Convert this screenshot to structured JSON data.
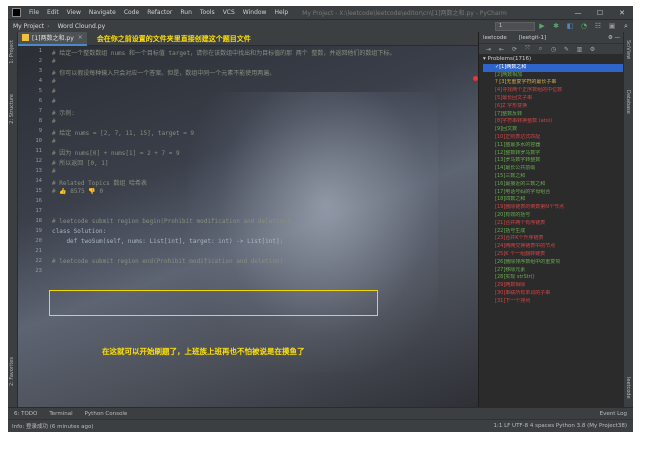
{
  "menubar": {
    "items": [
      "File",
      "Edit",
      "View",
      "Navigate",
      "Code",
      "Refactor",
      "Run",
      "Tools",
      "VCS",
      "Window",
      "Help"
    ],
    "window_title": "My Project - X:\\leetcode\\leetcode\\editor\\cn\\[1]两数之和.py - PyCharm",
    "controls": [
      "—",
      "☐",
      "✕"
    ]
  },
  "navbar": {
    "project": "My Project",
    "file": "Word Clound.py",
    "run_config": "1"
  },
  "editor": {
    "tab_label": "[1]两数之和.py",
    "hint": "会在你之前设置的文件夹里直接创建这个题目文件",
    "annotation": "在这就可以开始刷题了，上班族上班再也不怕被说是在摸鱼了",
    "lines": [
      {
        "n": "1",
        "text": "# 给定一个整数数组 nums 和一个目标值 target，请你在该数组中找出和为目标值的那 两个 整数，并返回他们的数组下标。",
        "kind": "comment"
      },
      {
        "n": "2",
        "text": "#",
        "kind": "comment"
      },
      {
        "n": "3",
        "text": "# 你可以假设每种输入只会对应一个答案。但是，数组中同一个元素不能使用两遍。",
        "kind": "comment"
      },
      {
        "n": "4",
        "text": "#",
        "kind": "comment"
      },
      {
        "n": "5",
        "text": "#",
        "kind": "comment"
      },
      {
        "n": "6",
        "text": "#",
        "kind": "comment"
      },
      {
        "n": "7",
        "text": "# 示例:",
        "kind": "comment"
      },
      {
        "n": "8",
        "text": "#",
        "kind": "comment"
      },
      {
        "n": "9",
        "text": "# 给定 nums = [2, 7, 11, 15], target = 9",
        "kind": "comment"
      },
      {
        "n": "10",
        "text": "#",
        "kind": "comment"
      },
      {
        "n": "11",
        "text": "# 因为 nums[0] + nums[1] = 2 + 7 = 9",
        "kind": "comment"
      },
      {
        "n": "12",
        "text": "# 所以返回 [0, 1]",
        "kind": "comment"
      },
      {
        "n": "13",
        "text": "#",
        "kind": "comment"
      },
      {
        "n": "14",
        "text": "# Related Topics 数组 哈希表",
        "kind": "comment"
      },
      {
        "n": "15",
        "text": "# 👍 8575 👎 0",
        "kind": "comment"
      },
      {
        "n": "16",
        "text": "",
        "kind": "blank"
      },
      {
        "n": "17",
        "text": "",
        "kind": "blank"
      },
      {
        "n": "18",
        "text": "# leetcode submit region begin(Prohibit modification and deletion)",
        "kind": "comment"
      },
      {
        "n": "19",
        "text": "class Solution:",
        "kind": "class"
      },
      {
        "n": "20",
        "text": "    def twoSum(self, nums: List[int], target: int) -> List[int]:",
        "kind": "def"
      },
      {
        "n": "21",
        "text": "",
        "kind": "blank"
      },
      {
        "n": "22",
        "text": "# leetcode submit region end(Prohibit modification and deletion)",
        "kind": "comment"
      },
      {
        "n": "23",
        "text": "",
        "kind": "blank"
      }
    ]
  },
  "leetcode": {
    "title": "leetcode",
    "account": "[leetgit-1]",
    "root": "Problems(1716)",
    "problems": [
      {
        "label": "✓[1]两数之和",
        "status": "sel"
      },
      {
        "label": "[2]两数相加",
        "status": "green"
      },
      {
        "label": "? [3]无重复字符的最长子串",
        "status": "gold"
      },
      {
        "label": "[4]寻找两个正序数组的中位数",
        "status": "red"
      },
      {
        "label": "[5]最长回文子串",
        "status": "red"
      },
      {
        "label": "[6]Z 字形变换",
        "status": "red"
      },
      {
        "label": "[7]整数反转",
        "status": "green"
      },
      {
        "label": "[8]字符串转换整数 (atoi)",
        "status": "red"
      },
      {
        "label": "[9]回文数",
        "status": "green"
      },
      {
        "label": "[10]正则表达式匹配",
        "status": "red"
      },
      {
        "label": "[11]盛最多水的容器",
        "status": "green"
      },
      {
        "label": "[12]整数转罗马数字",
        "status": "green"
      },
      {
        "label": "[13]罗马数字转整数",
        "status": "green"
      },
      {
        "label": "[14]最长公共前缀",
        "status": "green"
      },
      {
        "label": "[15]三数之和",
        "status": "green"
      },
      {
        "label": "[16]最接近的三数之和",
        "status": "green"
      },
      {
        "label": "[17]电话号码的字母组合",
        "status": "green"
      },
      {
        "label": "[18]四数之和",
        "status": "green"
      },
      {
        "label": "[19]删除链表的倒数第N个节点",
        "status": "red"
      },
      {
        "label": "[20]有效的括号",
        "status": "green"
      },
      {
        "label": "[21]合并两个有序链表",
        "status": "red"
      },
      {
        "label": "[22]括号生成",
        "status": "green"
      },
      {
        "label": "[23]合并K个升序链表",
        "status": "red"
      },
      {
        "label": "[24]两两交换链表中的节点",
        "status": "red"
      },
      {
        "label": "[25]K 个一组翻转链表",
        "status": "red"
      },
      {
        "label": "[26]删除排序数组中的重复项",
        "status": "green"
      },
      {
        "label": "[27]移除元素",
        "status": "green"
      },
      {
        "label": "[28]实现 strStr()",
        "status": "green"
      },
      {
        "label": "[29]两数相除",
        "status": "red"
      },
      {
        "label": "[30]串联所有单词的子串",
        "status": "red"
      },
      {
        "label": "[31]下一个排列",
        "status": "red"
      }
    ]
  },
  "left_strip": {
    "tabs": [
      "1: Project",
      "2: Structure",
      "2: Favorites"
    ]
  },
  "right_strip": {
    "tabs": [
      "SciView",
      "Database",
      "leetcode"
    ]
  },
  "bottom": {
    "tabs": [
      "6: TODO",
      "Terminal",
      "Python Console"
    ],
    "event_log": "Event Log"
  },
  "status": {
    "message": "Info: 登录成功 (6 minutes ago)",
    "right": "1:1  LF  UTF-8  4 spaces  Python 3.8 (My Project38)"
  },
  "colors": {
    "accent": "#2f65ca",
    "highlight_box": "#f2d600",
    "annotation_text": "#ffe000",
    "solved": "#6aab4f",
    "unsolved": "#d14646"
  }
}
